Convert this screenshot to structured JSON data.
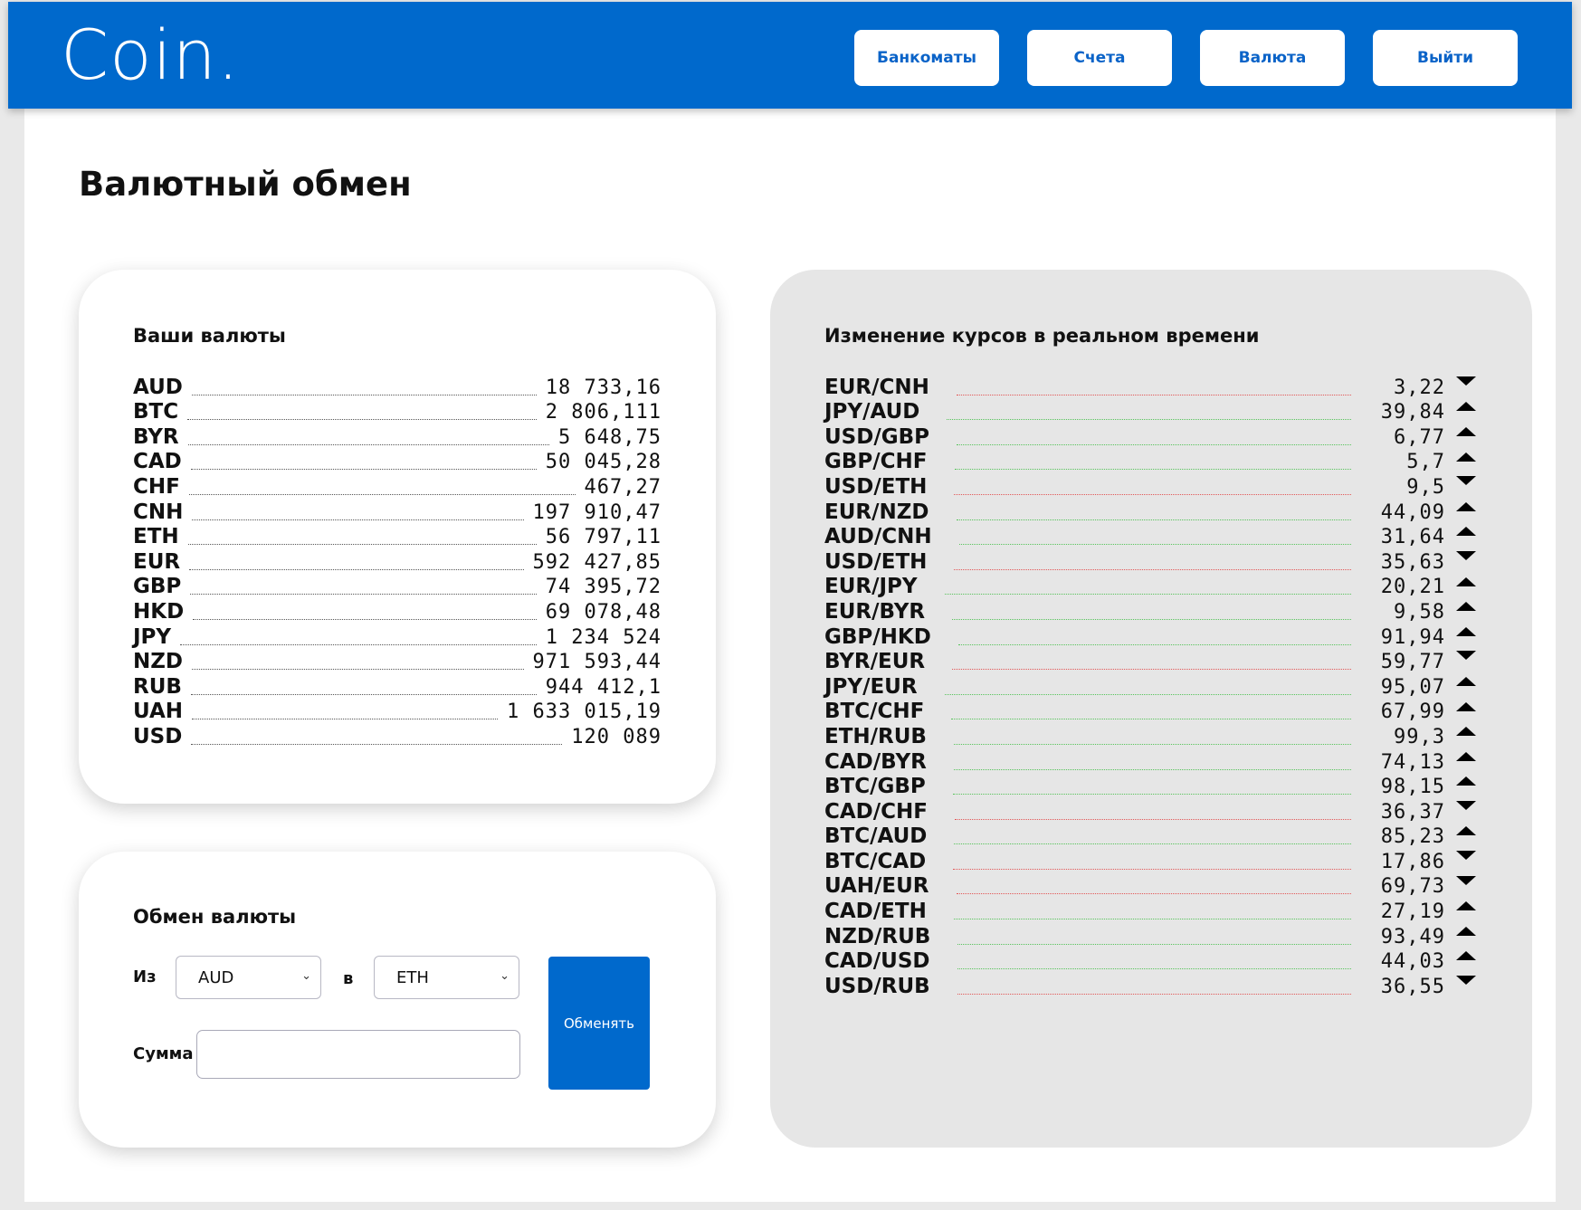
{
  "header": {
    "logo": "Coin.",
    "nav": [
      "Банкоматы",
      "Счета",
      "Валюта",
      "Выйти"
    ]
  },
  "page": {
    "title": "Валютный обмен"
  },
  "balances": {
    "title": "Ваши валюты",
    "items": [
      {
        "code": "AUD",
        "amount": "18 733,16"
      },
      {
        "code": "BTC",
        "amount": "2 806,111"
      },
      {
        "code": "BYR",
        "amount": "5 648,75"
      },
      {
        "code": "CAD",
        "amount": "50 045,28"
      },
      {
        "code": "CHF",
        "amount": "467,27"
      },
      {
        "code": "CNH",
        "amount": "197 910,47"
      },
      {
        "code": "ETH",
        "amount": "56 797,11"
      },
      {
        "code": "EUR",
        "amount": "592 427,85"
      },
      {
        "code": "GBP",
        "amount": "74 395,72"
      },
      {
        "code": "HKD",
        "amount": "69 078,48"
      },
      {
        "code": "JPY",
        "amount": "1 234 524"
      },
      {
        "code": "NZD",
        "amount": "971 593,44"
      },
      {
        "code": "RUB",
        "amount": "944 412,1"
      },
      {
        "code": "UAH",
        "amount": "1 633 015,19"
      },
      {
        "code": "USD",
        "amount": "120 089"
      }
    ]
  },
  "exchange": {
    "title": "Обмен валюты",
    "from_label": "Из",
    "from_value": "AUD",
    "to_label": "в",
    "to_value": "ETH",
    "amount_label": "Сумма",
    "amount_value": "",
    "submit_label": "Обменять"
  },
  "rates": {
    "title": "Изменение курсов в реальном времени",
    "up_color": "#56c35a",
    "down_color": "#e25656",
    "items": [
      {
        "pair": "EUR/CNH",
        "rate": "3,22",
        "direction": "down"
      },
      {
        "pair": "JPY/AUD",
        "rate": "39,84",
        "direction": "up"
      },
      {
        "pair": "USD/GBP",
        "rate": "6,77",
        "direction": "up"
      },
      {
        "pair": "GBP/CHF",
        "rate": "5,7",
        "direction": "up"
      },
      {
        "pair": "USD/ETH",
        "rate": "9,5",
        "direction": "down"
      },
      {
        "pair": "EUR/NZD",
        "rate": "44,09",
        "direction": "up"
      },
      {
        "pair": "AUD/CNH",
        "rate": "31,64",
        "direction": "up"
      },
      {
        "pair": "USD/ETH",
        "rate": "35,63",
        "direction": "down"
      },
      {
        "pair": "EUR/JPY",
        "rate": "20,21",
        "direction": "up"
      },
      {
        "pair": "EUR/BYR",
        "rate": "9,58",
        "direction": "up"
      },
      {
        "pair": "GBP/HKD",
        "rate": "91,94",
        "direction": "up"
      },
      {
        "pair": "BYR/EUR",
        "rate": "59,77",
        "direction": "down"
      },
      {
        "pair": "JPY/EUR",
        "rate": "95,07",
        "direction": "up"
      },
      {
        "pair": "BTC/CHF",
        "rate": "67,99",
        "direction": "up"
      },
      {
        "pair": "ETH/RUB",
        "rate": "99,3",
        "direction": "up"
      },
      {
        "pair": "CAD/BYR",
        "rate": "74,13",
        "direction": "up"
      },
      {
        "pair": "BTC/GBP",
        "rate": "98,15",
        "direction": "up"
      },
      {
        "pair": "CAD/CHF",
        "rate": "36,37",
        "direction": "down"
      },
      {
        "pair": "BTC/AUD",
        "rate": "85,23",
        "direction": "up"
      },
      {
        "pair": "BTC/CAD",
        "rate": "17,86",
        "direction": "down"
      },
      {
        "pair": "UAH/EUR",
        "rate": "69,73",
        "direction": "down"
      },
      {
        "pair": "CAD/ETH",
        "rate": "27,19",
        "direction": "up"
      },
      {
        "pair": "NZD/RUB",
        "rate": "93,49",
        "direction": "up"
      },
      {
        "pair": "CAD/USD",
        "rate": "44,03",
        "direction": "up"
      },
      {
        "pair": "USD/RUB",
        "rate": "36,55",
        "direction": "down"
      }
    ]
  }
}
